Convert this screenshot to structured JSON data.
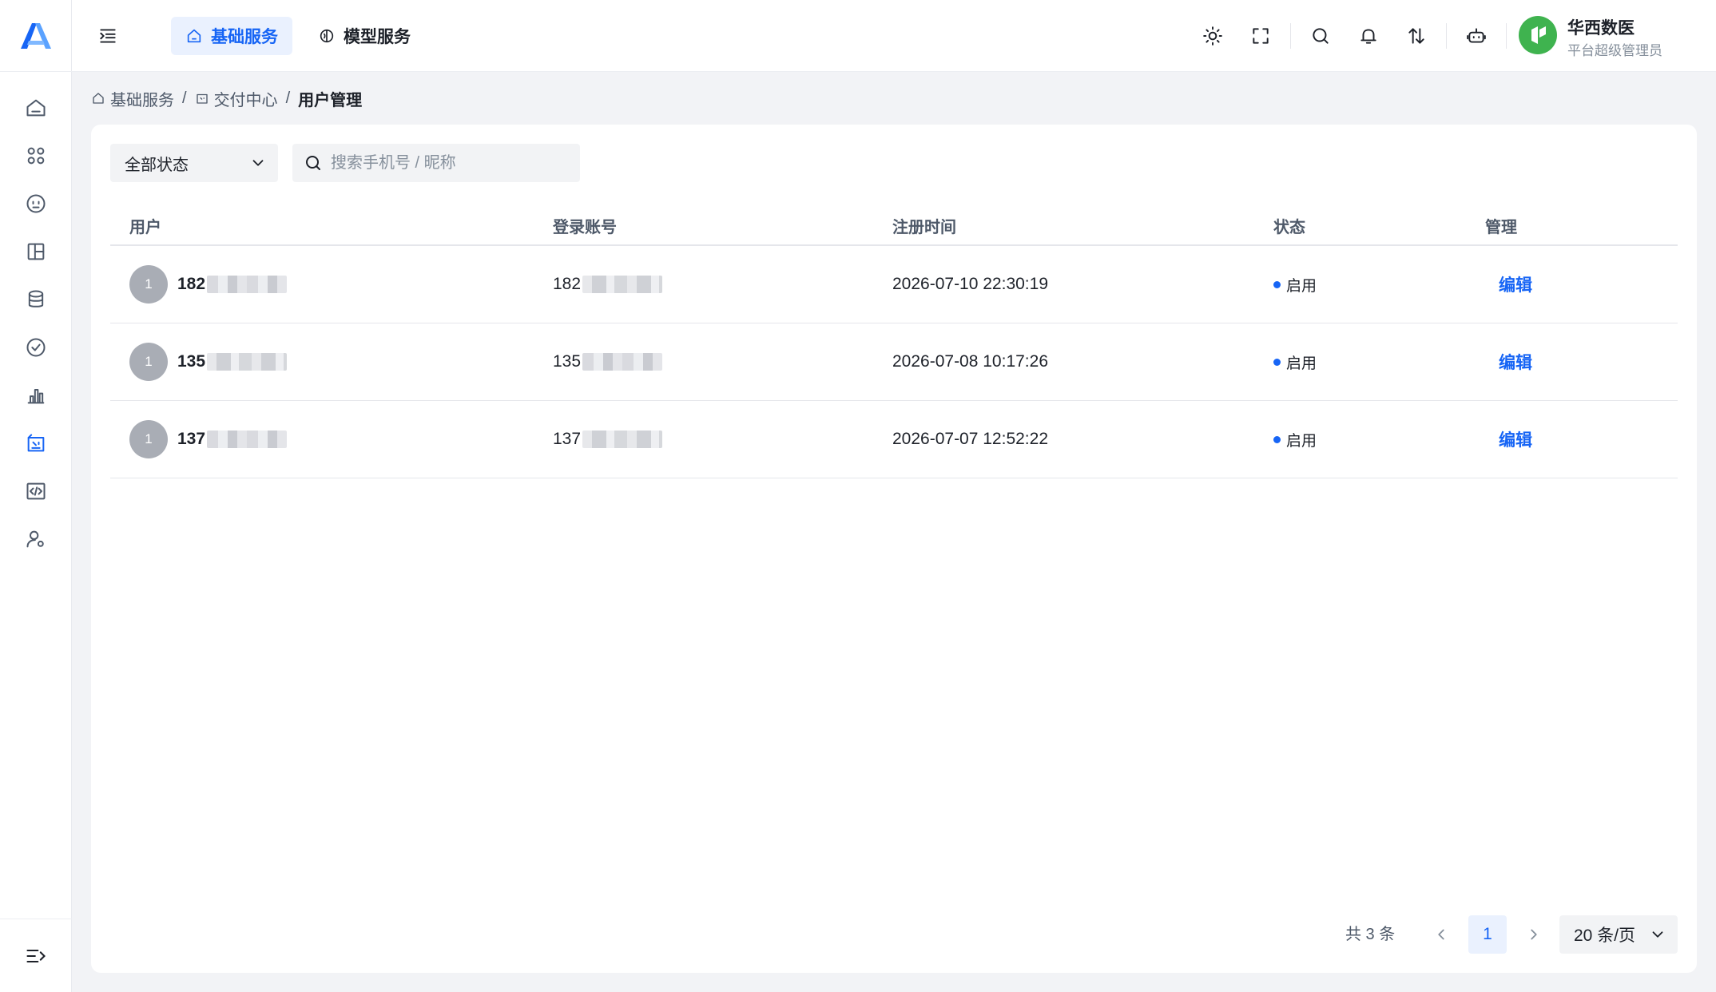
{
  "header": {
    "tabs": [
      {
        "label": "基础服务",
        "active": true
      },
      {
        "label": "模型服务",
        "active": false
      }
    ],
    "org": {
      "name": "华西数医",
      "role": "平台超级管理员"
    }
  },
  "breadcrumb": {
    "items": [
      "基础服务",
      "交付中心"
    ],
    "current": "用户管理"
  },
  "filters": {
    "status_select": "全部状态",
    "search_placeholder": "搜索手机号 / 昵称"
  },
  "table": {
    "columns": [
      "用户",
      "登录账号",
      "注册时间",
      "状态",
      "管理"
    ],
    "rows": [
      {
        "avatar": "1",
        "user": "182",
        "account": "182",
        "registered": "2026-07-10 22:30:19",
        "status": "启用",
        "action": "编辑"
      },
      {
        "avatar": "1",
        "user": "135",
        "account": "135",
        "registered": "2026-07-08 10:17:26",
        "status": "启用",
        "action": "编辑"
      },
      {
        "avatar": "1",
        "user": "137",
        "account": "137",
        "registered": "2026-07-07 12:52:22",
        "status": "启用",
        "action": "编辑"
      }
    ]
  },
  "pagination": {
    "total": "共 3 条",
    "current_page": "1",
    "page_size": "20 条/页"
  },
  "colors": {
    "accent": "#1765f5",
    "brand_green": "#3fb34f"
  }
}
